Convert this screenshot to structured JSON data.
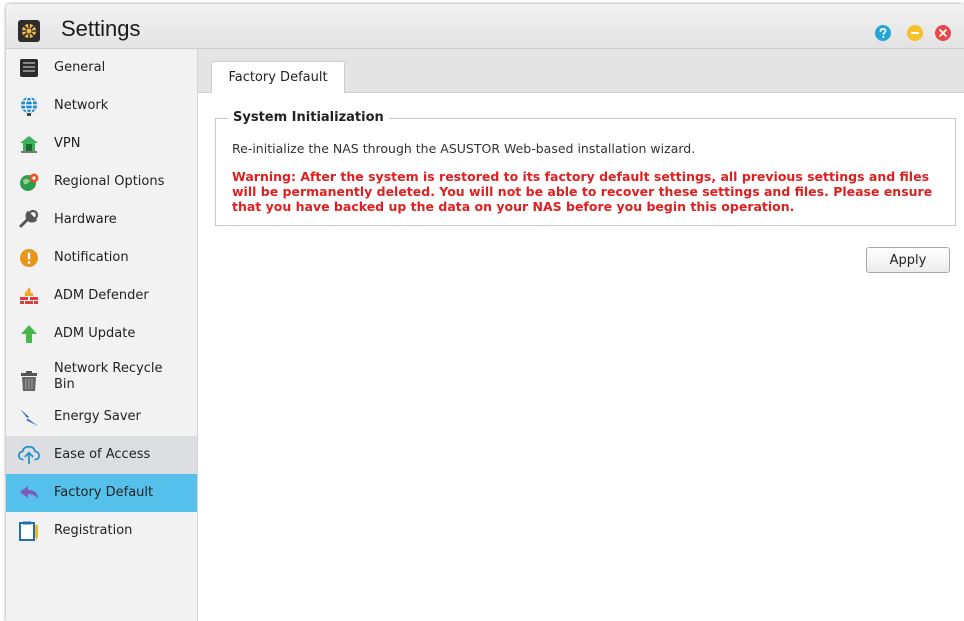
{
  "window": {
    "title": "Settings",
    "controls": {
      "help_icon": "help-icon",
      "minimize_icon": "minimize-icon",
      "close_icon": "close-icon"
    }
  },
  "sidebar": {
    "items": [
      {
        "label": "General",
        "icon": "general-icon"
      },
      {
        "label": "Network",
        "icon": "network-globe-icon"
      },
      {
        "label": "VPN",
        "icon": "vpn-icon"
      },
      {
        "label": "Regional Options",
        "icon": "regional-options-icon"
      },
      {
        "label": "Hardware",
        "icon": "hardware-icon"
      },
      {
        "label": "Notification",
        "icon": "notification-icon"
      },
      {
        "label": "ADM Defender",
        "icon": "adm-defender-icon"
      },
      {
        "label": "ADM Update",
        "icon": "adm-update-icon"
      },
      {
        "label": "Network Recycle Bin",
        "icon": "recycle-bin-icon"
      },
      {
        "label": "Energy Saver",
        "icon": "energy-saver-icon"
      },
      {
        "label": "Ease of Access",
        "icon": "ease-of-access-icon",
        "state": "hovered"
      },
      {
        "label": "Factory Default",
        "icon": "factory-default-icon",
        "state": "selected"
      },
      {
        "label": "Registration",
        "icon": "registration-icon"
      }
    ]
  },
  "main": {
    "tab": "Factory Default",
    "section_title": "System Initialization",
    "description": "Re-initialize the NAS through the ASUSTOR Web-based installation wizard.",
    "warning": "Warning: After the system is restored to its factory default settings, all previous settings and files will be permanently deleted. You will not be able to recover these settings and files. Please ensure that you have backed up the data on your NAS before you begin this operation.",
    "apply_label": "Apply"
  },
  "colors": {
    "selected": "#55c1ea",
    "hovered": "#dcdee2",
    "warning": "#e02020",
    "help": "#26a6d7",
    "minimize": "#f7c12a",
    "close": "#e9474a"
  }
}
